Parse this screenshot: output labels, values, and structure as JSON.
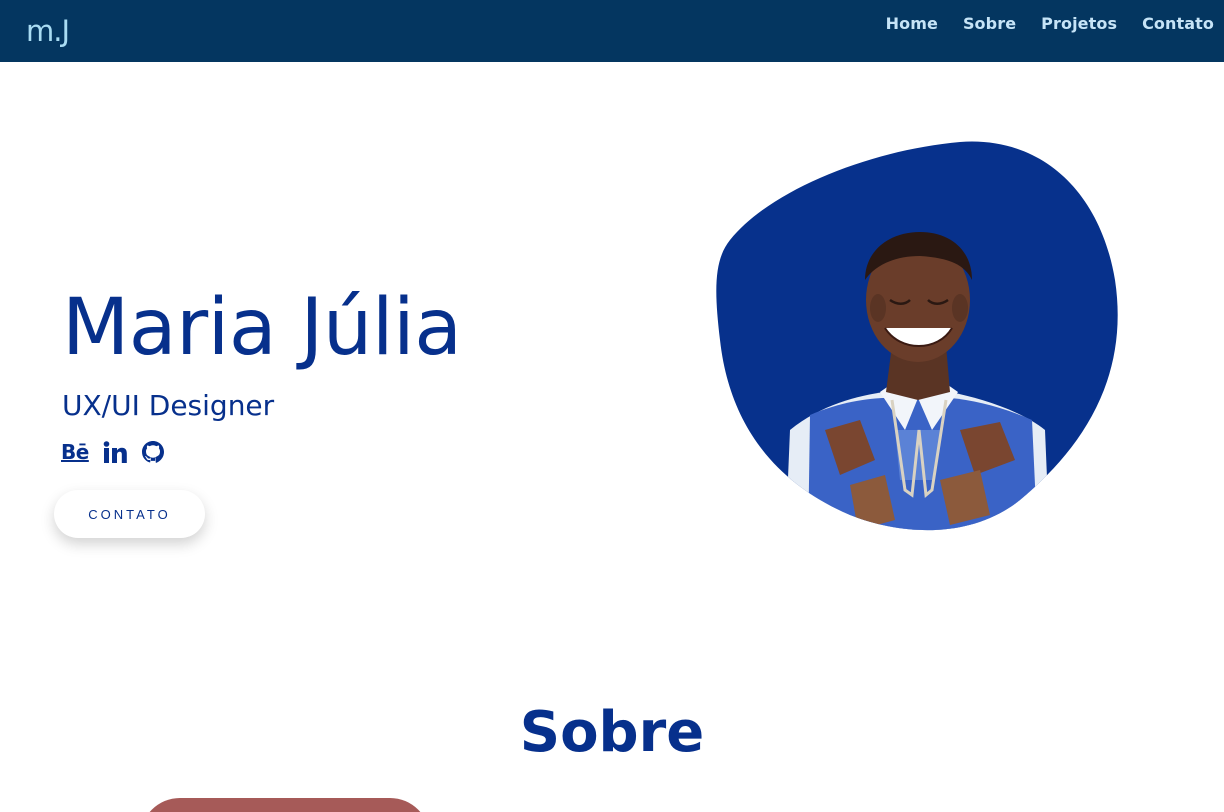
{
  "header": {
    "logo": "m.J",
    "nav": [
      "Home",
      "Sobre",
      "Projetos",
      "Contato"
    ]
  },
  "hero": {
    "name": "Maria Júlia",
    "role": "UX/UI Designer",
    "socials": [
      "behance-icon",
      "linkedin-icon",
      "github-icon"
    ],
    "behance_label": "Bē",
    "cta_label": "CONTATO"
  },
  "about": {
    "title": "Sobre"
  },
  "colors": {
    "header_bg": "#043660",
    "accent": "#07308c",
    "logo": "#a9dcf3"
  }
}
